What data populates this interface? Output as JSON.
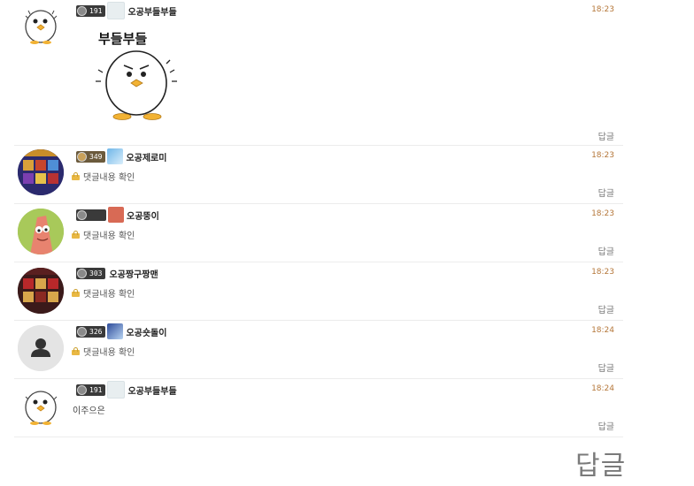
{
  "comments": [
    {
      "level": "191",
      "nickname": "오공부들부들",
      "time": "18:23",
      "sticker_text": "부들부들",
      "reply_label": "답글",
      "avatar": "duck-icon"
    },
    {
      "level": "349",
      "nickname": "오공제로미",
      "time": "18:23",
      "content": "댓글내용 확인",
      "reply_label": "답글",
      "avatar": "slot-game-icon"
    },
    {
      "level": "",
      "nickname": "오공뚱이",
      "time": "18:23",
      "content": "댓글내용 확인",
      "reply_label": "답글",
      "avatar": "patrick-icon"
    },
    {
      "level": "303",
      "nickname": "오공짱구짱맨",
      "time": "18:23",
      "content": "댓글내용 확인",
      "reply_label": "답글",
      "avatar": "slot-game-icon"
    },
    {
      "level": "326",
      "nickname": "오공숏돌이",
      "time": "18:24",
      "content": "댓글내용 확인",
      "reply_label": "답글",
      "avatar": "default-user-icon"
    },
    {
      "level": "191",
      "nickname": "오공부들부들",
      "time": "18:24",
      "content": "이주으은",
      "reply_label": "답글",
      "avatar": "duck-icon"
    }
  ],
  "zoomed_reply_label": "답글",
  "colors": {
    "time": "#b5773a",
    "lock": "#e9b843",
    "level_badge": "#3a3a3a"
  }
}
